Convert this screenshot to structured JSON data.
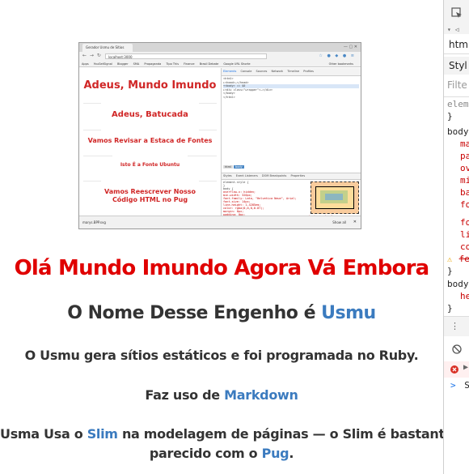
{
  "browser": {
    "tab_title": "Gerador Usmu de Sítios",
    "url": "localhost:3000",
    "bookmarks": [
      "Apps",
      "YouGetSignal",
      "Blogger",
      "SMA",
      "Propaganda",
      "Tipo This",
      "Finance",
      "Brasil Debate",
      "Google URL Shorte"
    ],
    "bookmarks_other": "Other bookmarks",
    "viewport_lines": [
      "Adeus, Mundo Imundo",
      "Adeus, Batucada",
      "Vamos Revisar a Estaca de Fontes",
      "Isto É a Fonte Ubuntu",
      "Vamos Reescrever Nosso",
      "Código HTML no Pug"
    ],
    "devtools_tabs": [
      "Elements",
      "Console",
      "Sources",
      "Network",
      "Timeline",
      "Profiles"
    ],
    "devtools_active_tab": "Elements",
    "dom_lines": [
      "<html>",
      "▸<head>…</head>",
      "▾<body> == $0",
      "  ▸<div class=\"wrapper\">…</div>",
      "  </body>",
      "</html>"
    ],
    "breadcrumb": [
      "html",
      "body"
    ],
    "styles_tabs": [
      "Styles",
      "Event Listeners",
      "DOM Breakpoints",
      "Properties"
    ],
    "styles_lines": [
      "element.style {",
      "}",
      "body {",
      "  overflow-x: hidden;",
      "  min-width: 320px;",
      "  font-family: Lato, \"Helvetica Neue\", Arial;",
      "  font-size: 14px;",
      "  line-height: 1.4285em;",
      "  color: rgba(0,0,0,0.87);",
      "  margin: 0px;",
      "  padding: 0px;",
      "  background-color: #fff;",
      "}",
      "html, body {",
      "  height: 100%;"
    ],
    "boxmodel_labels": [
      "margin",
      "border",
      "padding"
    ],
    "computed_lines": [
      "background-colo",
      "background-imag",
      "background-orig",
      "background-posi",
      "background-size"
    ],
    "download_item": "marys.BPP.svg",
    "downloads_show_all": "Show all"
  },
  "heading1": "Olá Mundo Imundo Agora Vá Embora",
  "heading2": {
    "prefix": "O Nome Desse Engenho é ",
    "link": "Usmu"
  },
  "paragraphs": {
    "p1": "O Usmu gera sítios estáticos e foi programada no Ruby.",
    "p2_prefix": "Faz uso de ",
    "p2_link": "Markdown",
    "p3_prefix": "Usma Usa o ",
    "p3_link1": "Slim",
    "p3_middle": " na modelagem de páginas — o Slim é bastante",
    "p3_line2_prefix": "parecido com o ",
    "p3_link2": "Pug",
    "p3_end": "."
  },
  "side_panel": {
    "tab_labels": [
      "html",
      "Styl",
      "Filte"
    ],
    "lines": [
      "elem",
      "}",
      "body",
      "ma",
      "pa",
      "ov",
      "mi",
      "ba",
      "fo",
      "fo",
      "li",
      "co",
      "fe",
      "}",
      "body",
      "he",
      "}"
    ],
    "console_prompt": ">",
    "console_s": "S"
  },
  "colors": {
    "heading1": "#e00000",
    "link": "#3b7bbf",
    "text": "#333333",
    "viewport_red": "#d02626"
  }
}
